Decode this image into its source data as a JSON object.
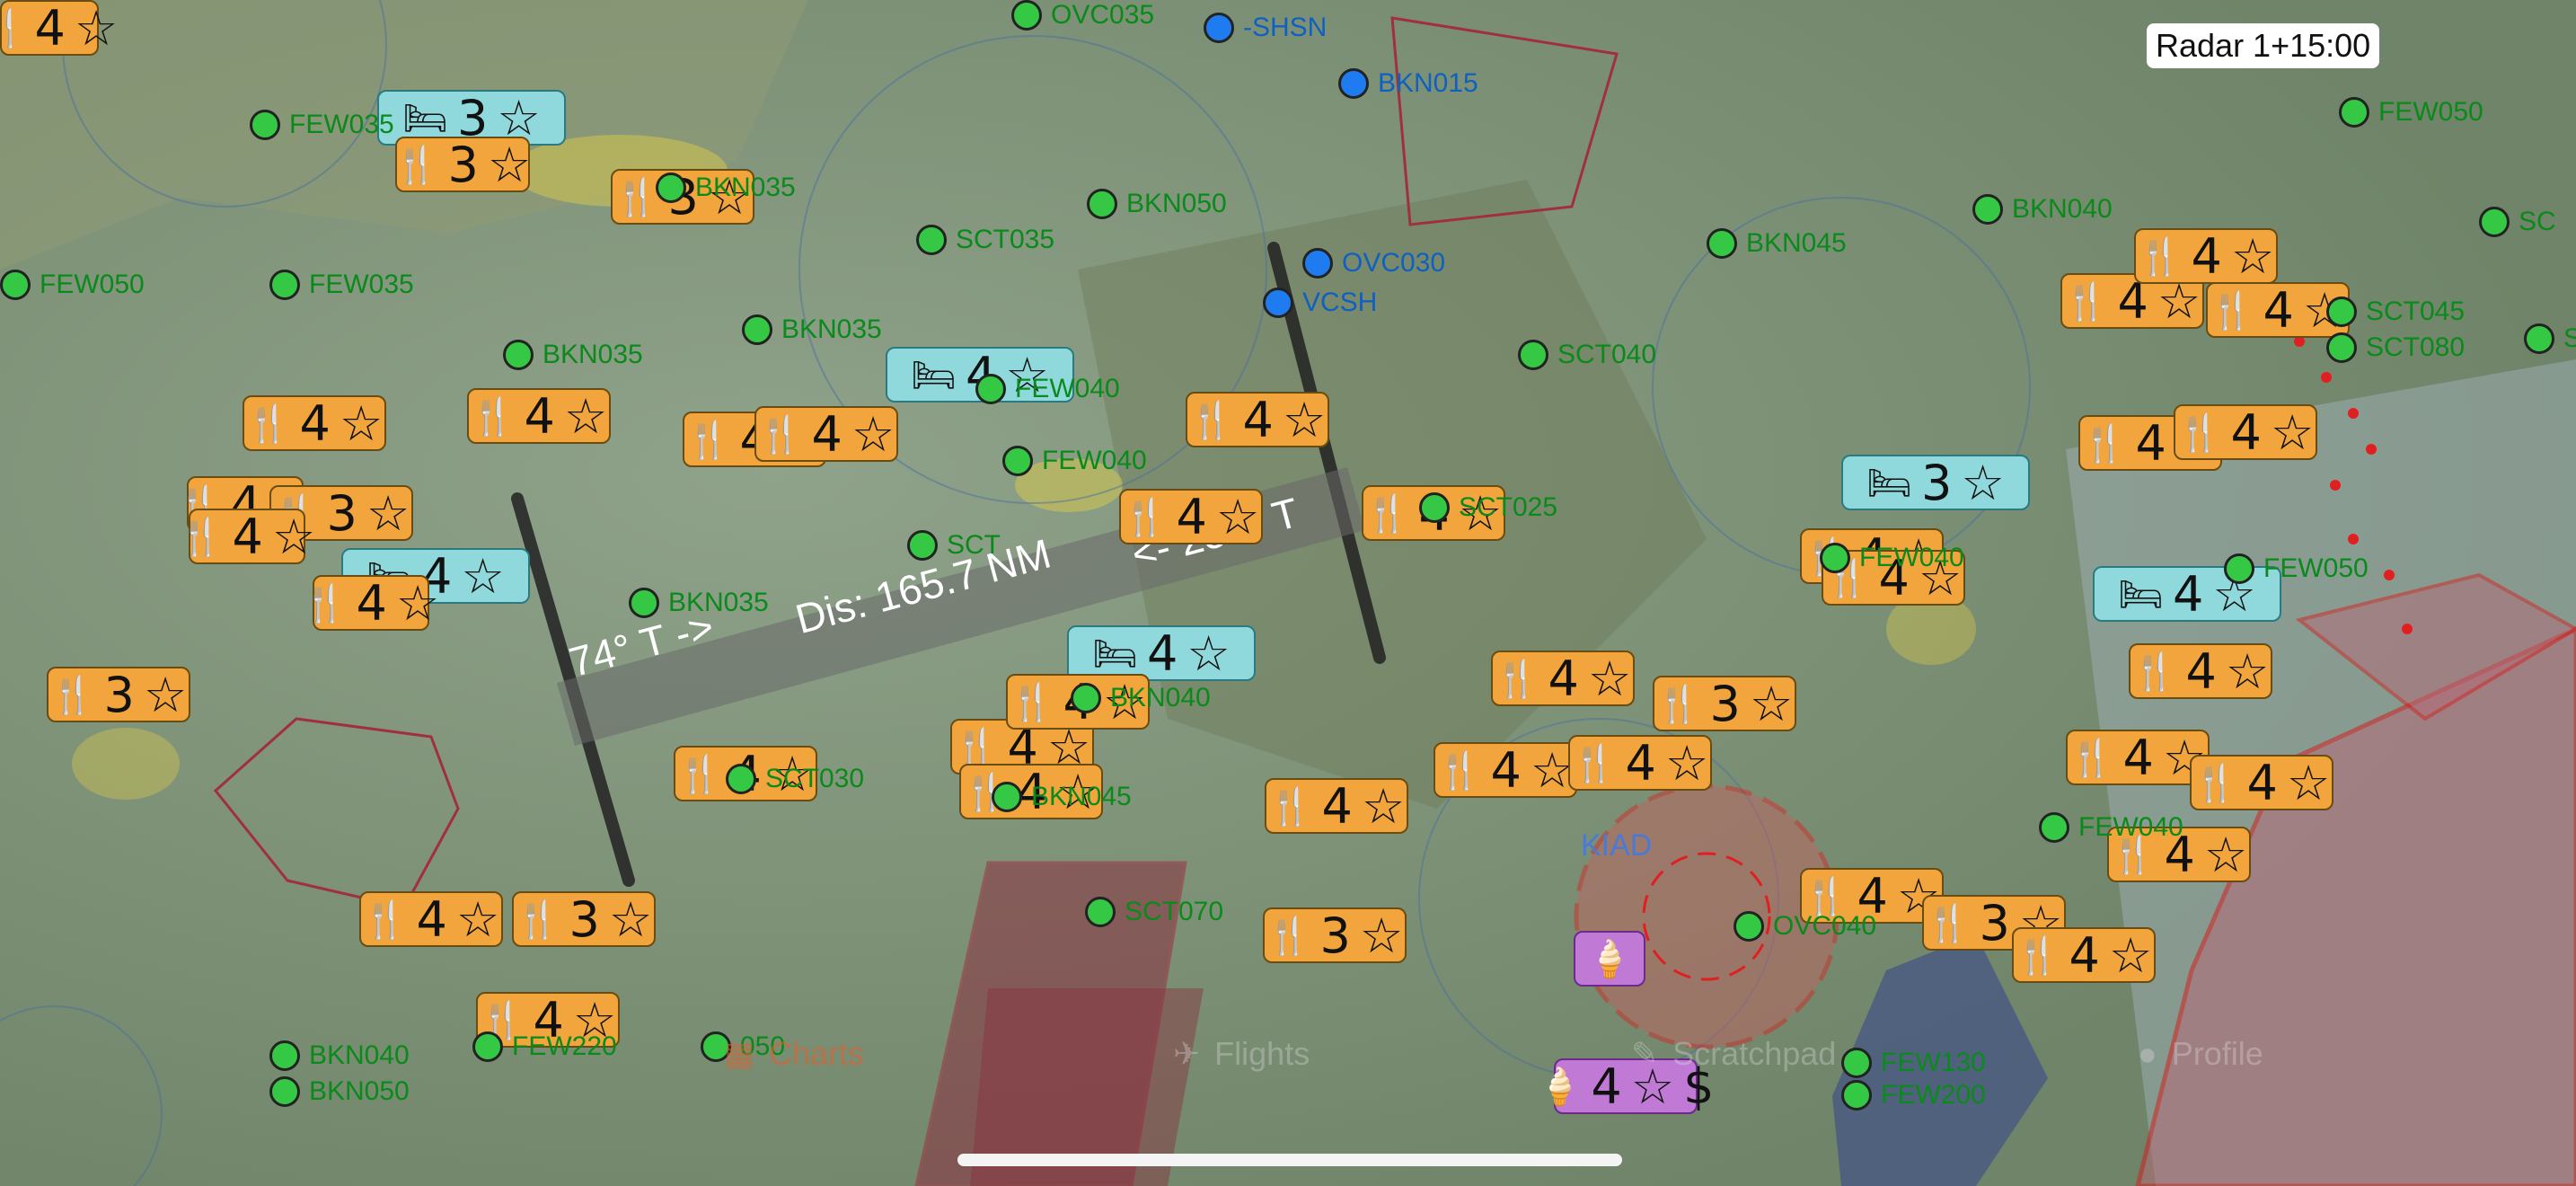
{
  "radar": {
    "label": "Radar 1+15:00"
  },
  "route": {
    "outbound_label": "74° T ->",
    "distance_label": "Dis: 165.7 NM",
    "return_label": "<- 254° T"
  },
  "airport_label": "KIAD",
  "tabs": [
    {
      "label": "Charts",
      "icon": "charts-icon",
      "active": true
    },
    {
      "label": "Flights",
      "icon": "airplane-icon",
      "active": false
    },
    {
      "label": "Scratchpad",
      "icon": "scratchpad-icon",
      "active": false
    },
    {
      "label": "Profile",
      "icon": "person-icon",
      "active": false
    }
  ],
  "badges": [
    {
      "type": "food",
      "rating": "4"
    },
    {
      "type": "hotel",
      "rating": "3"
    },
    {
      "type": "food",
      "rating": "3"
    },
    {
      "type": "food",
      "rating": "4"
    },
    {
      "type": "food",
      "rating": "4"
    },
    {
      "type": "food",
      "rating": "3"
    },
    {
      "type": "food",
      "rating": "4"
    },
    {
      "type": "food",
      "rating": "3"
    },
    {
      "type": "food",
      "rating": "4"
    },
    {
      "type": "hotel",
      "rating": "4"
    },
    {
      "type": "food",
      "rating": "4"
    },
    {
      "type": "food",
      "rating": "3"
    },
    {
      "type": "food",
      "rating": "4"
    },
    {
      "type": "food",
      "rating": "3"
    },
    {
      "type": "food",
      "rating": "4"
    },
    {
      "type": "food",
      "rating": "4"
    },
    {
      "type": "food",
      "rating": "4"
    },
    {
      "type": "hotel",
      "rating": "4"
    },
    {
      "type": "food",
      "rating": "4"
    },
    {
      "type": "food",
      "rating": "4"
    },
    {
      "type": "food",
      "rating": "4"
    },
    {
      "type": "hotel",
      "rating": "4"
    },
    {
      "type": "food",
      "rating": "4"
    },
    {
      "type": "food",
      "rating": "4"
    },
    {
      "type": "food",
      "rating": "3"
    },
    {
      "type": "food",
      "rating": "4"
    },
    {
      "type": "food",
      "rating": "4"
    },
    {
      "type": "food",
      "rating": "4"
    },
    {
      "type": "food",
      "rating": "4"
    },
    {
      "type": "food",
      "rating": "3"
    },
    {
      "type": "food",
      "rating": "4"
    },
    {
      "type": "food",
      "rating": "4"
    },
    {
      "type": "hotel",
      "rating": "3"
    },
    {
      "type": "food",
      "rating": "4"
    },
    {
      "type": "food",
      "rating": "4"
    },
    {
      "type": "food",
      "rating": "4"
    },
    {
      "type": "food",
      "rating": "4"
    },
    {
      "type": "food",
      "rating": "4"
    },
    {
      "type": "food",
      "rating": "4"
    },
    {
      "type": "food",
      "rating": "4"
    },
    {
      "type": "hotel",
      "rating": "4"
    },
    {
      "type": "food",
      "rating": "4"
    },
    {
      "type": "food",
      "rating": "4"
    },
    {
      "type": "food",
      "rating": "4"
    },
    {
      "type": "food",
      "rating": "4"
    },
    {
      "type": "food",
      "rating": "4"
    },
    {
      "type": "food",
      "rating": "3"
    },
    {
      "type": "food",
      "rating": "4"
    },
    {
      "type": "ice",
      "rating": ""
    },
    {
      "type": "ice",
      "rating": "4",
      "price": "$"
    }
  ],
  "metars": [
    {
      "text": "OVC035"
    },
    {
      "text": "-SHSN"
    },
    {
      "text": "BKN015"
    },
    {
      "text": "FEW035"
    },
    {
      "text": "BKN035"
    },
    {
      "text": "BKN050"
    },
    {
      "text": "SCT035"
    },
    {
      "text": "OVC030"
    },
    {
      "text": "VCSH"
    },
    {
      "text": "BKN040"
    },
    {
      "text": "BKN045"
    },
    {
      "text": "FEW050"
    },
    {
      "text": "FEW035"
    },
    {
      "text": "BKN035"
    },
    {
      "text": "BKN035"
    },
    {
      "text": "FEW040"
    },
    {
      "text": "SCT040"
    },
    {
      "text": "FEW040"
    },
    {
      "text": "SCT025"
    },
    {
      "text": "BKN035"
    },
    {
      "text": "SCT"
    },
    {
      "text": "BKN040"
    },
    {
      "text": "SCT030"
    },
    {
      "text": "BKN045"
    },
    {
      "text": "SCT070"
    },
    {
      "text": "FEW040"
    },
    {
      "text": "FEW050"
    },
    {
      "text": "FEW040"
    },
    {
      "text": "OVC040"
    },
    {
      "text": "FEW130"
    },
    {
      "text": "FEW200"
    },
    {
      "text": "BKN040"
    },
    {
      "text": "BKN050"
    },
    {
      "text": "FEW220"
    },
    {
      "text": "050"
    },
    {
      "text": "FEW050"
    },
    {
      "text": "SCT045"
    },
    {
      "text": "SCT080"
    },
    {
      "text": "SC"
    },
    {
      "text": "S"
    }
  ]
}
